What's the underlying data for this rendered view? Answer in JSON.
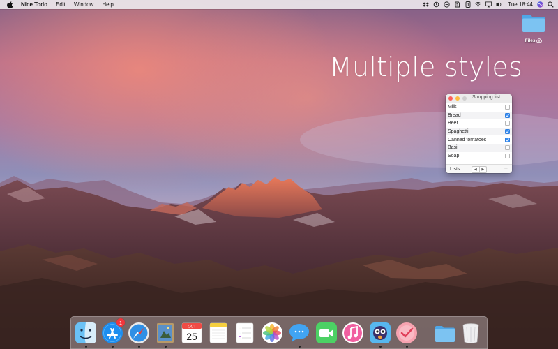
{
  "menubar": {
    "app_name": "Nice Todo",
    "items": [
      "Edit",
      "Window",
      "Help"
    ],
    "clock": "Tue 18:44",
    "status_icons": [
      "dropbox-icon",
      "sync-icon",
      "clock-icon",
      "evernote-icon",
      "icon-1",
      "wifi-icon",
      "airplay-icon",
      "volume-icon",
      "siri-icon",
      "spotlight-icon"
    ]
  },
  "desktop": {
    "headline": "Multiple styles",
    "folder_label": "Files"
  },
  "todo_window": {
    "title": "Shopping list",
    "items": [
      {
        "label": "Milk",
        "checked": false
      },
      {
        "label": "Bread",
        "checked": true
      },
      {
        "label": "Beer",
        "checked": false
      },
      {
        "label": "Spaghetti",
        "checked": true
      },
      {
        "label": "Canned tomatoes",
        "checked": true
      },
      {
        "label": "Basil",
        "checked": false
      },
      {
        "label": "Soap",
        "checked": false
      }
    ],
    "footer": {
      "lists_label": "Lists",
      "prev": "◀",
      "next": "▶",
      "add": "+"
    }
  },
  "dock": {
    "apps": [
      "finder",
      "app-store",
      "safari",
      "preview",
      "calendar",
      "notes",
      "reminders",
      "photos",
      "messages",
      "facetime",
      "itunes",
      "tweetbot",
      "nice-todo",
      "files-folder",
      "trash"
    ],
    "app_store_badge": "1",
    "calendar_month": "OCT",
    "calendar_day": "25"
  },
  "colors": {
    "checkbox_on": "#3a8ff3",
    "close": "#fc605b",
    "minimize": "#fdbc40"
  }
}
